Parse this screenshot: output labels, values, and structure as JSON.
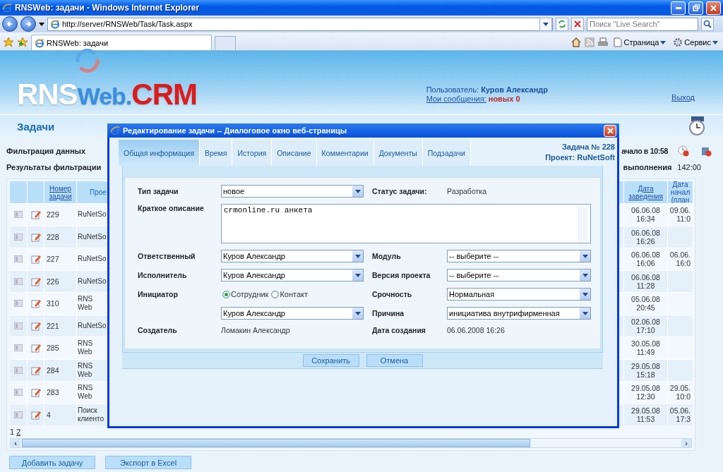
{
  "browser": {
    "title": "RNSWeb: задачи - Windows Internet Explorer",
    "address": "http://server/RNSWeb/Task/Task.aspx",
    "search": {
      "placeholder": "Поиск \"Live Search\""
    },
    "tab": "RNSWeb: задачи",
    "commands": [
      "Страница",
      "Сервис"
    ]
  },
  "header": {
    "logo": [
      {
        "text": "RNS",
        "color": "#ffffff"
      },
      {
        "text": "Web.",
        "color": "#3a8ee0"
      },
      {
        "text": "CRM",
        "color": "#e01a1a"
      }
    ],
    "user_label": "Пользователь:",
    "user_name": "Куров Александр",
    "messages_link": "Мои сообщения:",
    "messages_new": "новых",
    "messages_count": "0",
    "logout": "Выход",
    "section": "Задачи"
  },
  "filter": {
    "title": "Фильтрация данных",
    "results": "Результаты фильтрации",
    "timer": "ачало в 10:58",
    "duration_label": "выполнения",
    "duration_value": "142:00"
  },
  "table": {
    "columns": [
      {
        "label": "Номер задачи"
      },
      {
        "label": "Прое"
      },
      {
        "label": "Дата заведения"
      },
      {
        "label": "Дата начал (план"
      }
    ],
    "rows": [
      {
        "number": "229",
        "project": "RuNetSo",
        "created": "06.06.08\n16:34",
        "start": "09.06.\n11:0"
      },
      {
        "number": "228",
        "project": "RuNetSo",
        "created": "06.06.08\n16:26",
        "start": ""
      },
      {
        "number": "227",
        "project": "RuNetSo",
        "created": "06.06.08\n16:06",
        "start": "06.06.\n16:0"
      },
      {
        "number": "226",
        "project": "RuNetSo",
        "created": "06.06.08\n11:28",
        "start": ""
      },
      {
        "number": "310",
        "project": "RNS Web",
        "created": "05.06.08\n20:45",
        "start": ""
      },
      {
        "number": "221",
        "project": "RuNetSo",
        "created": "02.06.08\n17:10",
        "start": ""
      },
      {
        "number": "285",
        "project": "RNS Web",
        "created": "30.05.08\n11:49",
        "start": ""
      },
      {
        "number": "284",
        "project": "RNS Web",
        "created": "29.05.08\n15:18",
        "start": ""
      },
      {
        "number": "283",
        "project": "RNS Web",
        "created": "29.05.08\n12:30",
        "start": "29.05.\n10:0"
      },
      {
        "number": "4",
        "project": "Поиск\nклиенто",
        "created": "29.05.08\n11:53",
        "start": "05.06.\n17:3"
      }
    ],
    "pages": [
      {
        "label": "1",
        "selected": true
      },
      {
        "label": "2",
        "selected": false
      }
    ],
    "scroll_arrows": [
      "‹",
      "›"
    ]
  },
  "buttons": [
    "Добавить задачу",
    "Экспорт в Excel"
  ],
  "dialog": {
    "title": "Редактирование задачи -- Диалоговое окно веб-страницы",
    "tabs": [
      {
        "label": "Общая информация",
        "selected": true
      },
      {
        "label": "Время",
        "selected": false
      },
      {
        "label": "История",
        "selected": false
      },
      {
        "label": "Описание",
        "selected": false
      },
      {
        "label": "Комментарии",
        "selected": false
      },
      {
        "label": "Документы",
        "selected": false
      },
      {
        "label": "Подзадачи",
        "selected": false
      }
    ],
    "task_number": "Задача № 228",
    "project": "Проект: RuNetSoft",
    "rows": [
      {
        "label": "Тип задачи",
        "kind": "select",
        "value": "новое",
        "right": {
          "label": "Статус задачи:",
          "kind": "text",
          "value": "Разработка"
        }
      },
      {
        "label": "Краткое описание",
        "kind": "textarea",
        "value": "crmonline.ru анкета"
      },
      {
        "label": "Ответственный",
        "kind": "select",
        "value": "Куров Александр",
        "right": {
          "label": "Модуль",
          "kind": "select",
          "value": "-- выберите --"
        }
      },
      {
        "label": "Исполнитель",
        "kind": "select",
        "value": "Куров Александр",
        "right": {
          "label": "Версия проекта",
          "kind": "select",
          "value": "-- выберите --"
        }
      },
      {
        "label": "Инициатор",
        "kind": "radio",
        "options": [
          {
            "label": "Сотрудник",
            "selected": true
          },
          {
            "label": "Контакт",
            "selected": false
          }
        ],
        "right": {
          "label": "Срочность",
          "kind": "select",
          "value": "Нормальная"
        }
      },
      {
        "kind": "select",
        "value": "Куров Александр",
        "right": {
          "label": "Причина",
          "kind": "select",
          "value": "инициатива внутрифирменная"
        }
      },
      {
        "label": "Создатель",
        "kind": "text",
        "value": "Ломакин Александр",
        "right": {
          "label": "Дата создания",
          "kind": "text",
          "value": "06.06.2008 16:26"
        }
      }
    ],
    "buttons": [
      "Сохранить",
      "Отмена"
    ]
  }
}
